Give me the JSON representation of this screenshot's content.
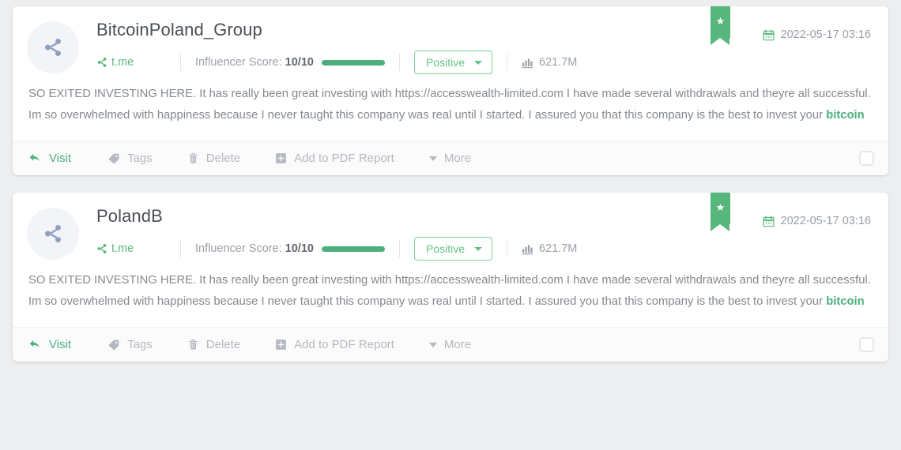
{
  "cards": [
    {
      "avatar_icon": "share-icon",
      "title": "BitcoinPoland_Group",
      "source": {
        "icon": "share-icon",
        "label": "t.me"
      },
      "influencer": {
        "label": "Influencer Score:",
        "value": "10/10",
        "bar_percent": 100
      },
      "sentiment": {
        "value": "Positive",
        "caret_icon": "chevron-down-icon"
      },
      "reach": {
        "icon": "bar-chart-icon",
        "value": "621.7M"
      },
      "bookmark": {
        "icon": "star-icon",
        "active": true
      },
      "date": {
        "icon": "calendar-icon",
        "value": "2022-05-17 03:16"
      },
      "body_before": "SO EXITED INVESTING HERE. It has really been great investing with https://accesswealth-limited.com I have made several withdrawals and theyre all successful. Im so overwhelmed with happiness because I never taught this company was real until I started. I assured you that this company is the best to invest your ",
      "body_keyword": "bitcoin",
      "body_after": "",
      "actions": {
        "visit": "Visit",
        "tags": "Tags",
        "delete": "Delete",
        "add_pdf": "Add to PDF Report",
        "more": "More"
      },
      "select_checked": false
    },
    {
      "avatar_icon": "share-icon",
      "title": "PolandB",
      "source": {
        "icon": "share-icon",
        "label": "t.me"
      },
      "influencer": {
        "label": "Influencer Score:",
        "value": "10/10",
        "bar_percent": 100
      },
      "sentiment": {
        "value": "Positive",
        "caret_icon": "chevron-down-icon"
      },
      "reach": {
        "icon": "bar-chart-icon",
        "value": "621.7M"
      },
      "bookmark": {
        "icon": "star-icon",
        "active": true
      },
      "date": {
        "icon": "calendar-icon",
        "value": "2022-05-17 03:16"
      },
      "body_before": "SO EXITED INVESTING HERE. It has really been great investing with https://accesswealth-limited.com I have made several withdrawals and theyre all successful. Im so overwhelmed with happiness because I never taught this company was real until I started. I assured you that this company is the best to invest your ",
      "body_keyword": "bitcoin",
      "body_after": "",
      "actions": {
        "visit": "Visit",
        "tags": "Tags",
        "delete": "Delete",
        "add_pdf": "Add to PDF Report",
        "more": "More"
      },
      "select_checked": false
    }
  ],
  "colors": {
    "accent_green": "#4caf7d",
    "ribbon_green": "#56b67c",
    "muted_text": "#9aa0a8",
    "body_text": "#84898f",
    "page_bg": "#eceef0"
  }
}
